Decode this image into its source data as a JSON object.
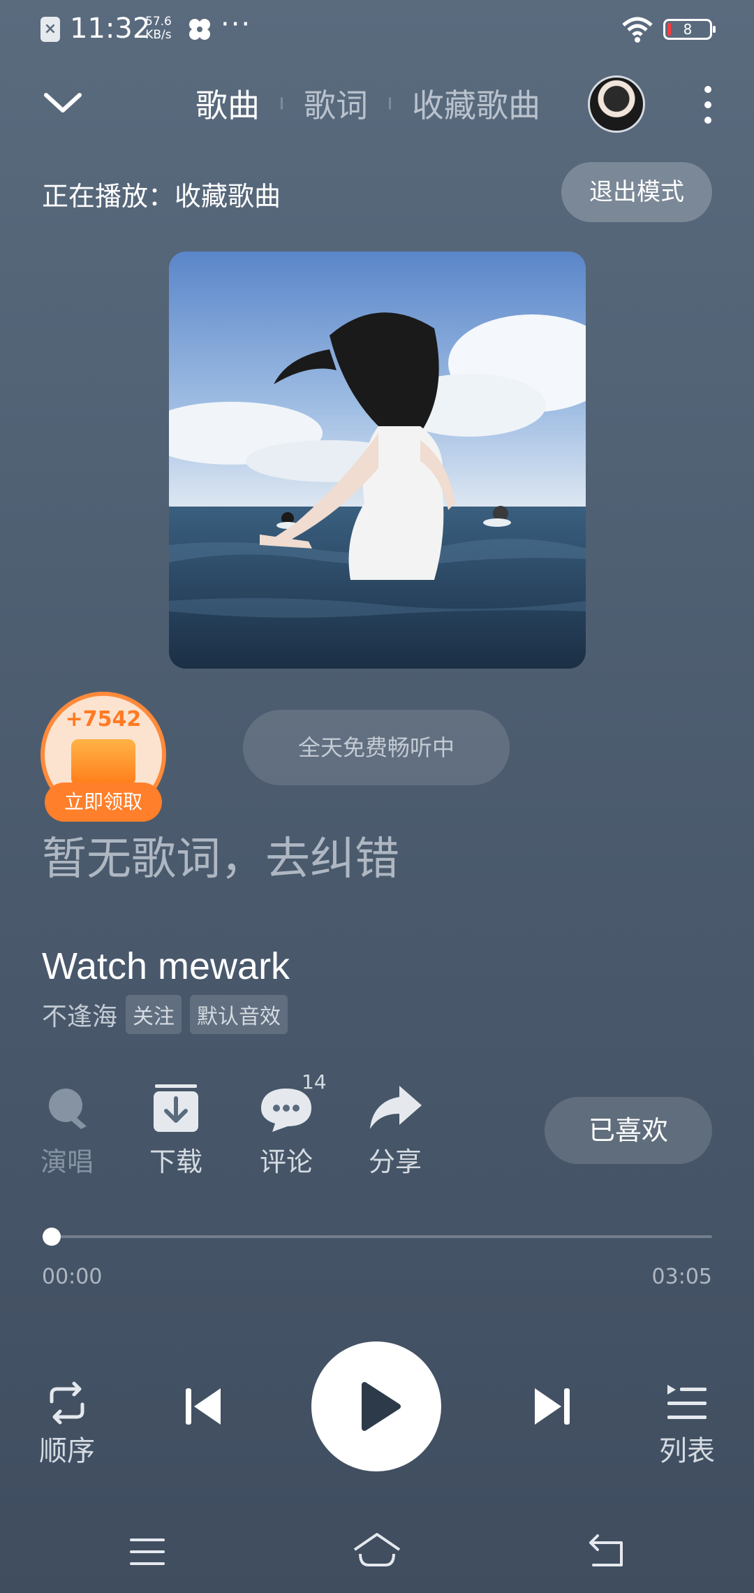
{
  "status_bar": {
    "time": "11:32",
    "speed_value": "57.6",
    "speed_unit": "KB/s",
    "battery": "8"
  },
  "header": {
    "tabs": [
      {
        "label": "歌曲",
        "active": true
      },
      {
        "label": "歌词",
        "active": false
      },
      {
        "label": "收藏歌曲",
        "active": false
      }
    ]
  },
  "now_playing": {
    "label": "正在播放：收藏歌曲",
    "exit_label": "退出模式"
  },
  "reward": {
    "count": "+7542",
    "claim_label": "立即领取"
  },
  "free_listen_label": "全天免费畅听中",
  "lyrics_placeholder": "暂无歌词，去纠错",
  "song": {
    "title": "Watch mewark",
    "artist": "不逢海",
    "follow_label": "关注",
    "effect_label": "默认音效"
  },
  "actions": {
    "sing_label": "演唱",
    "download_label": "下载",
    "comment_label": "评论",
    "comment_count": "14",
    "share_label": "分享",
    "liked_label": "已喜欢"
  },
  "progress": {
    "current": "00:00",
    "total": "03:05",
    "fraction": 0
  },
  "controls": {
    "mode_label": "顺序",
    "list_label": "列表"
  },
  "colors": {
    "accent_orange": "#ff7f2a",
    "background": "#4e5e71"
  },
  "icons": {
    "chevron": "chevron-down-icon",
    "more": "more-vertical-icon",
    "sing": "microphone-icon",
    "download": "download-icon",
    "comment": "comment-icon",
    "share": "share-icon",
    "repeat": "repeat-icon",
    "previous": "skip-previous-icon",
    "play": "play-icon",
    "next": "skip-next-icon",
    "playlist": "playlist-icon",
    "nav_menu": "menu-icon",
    "nav_home": "home-icon",
    "nav_back": "back-icon"
  }
}
